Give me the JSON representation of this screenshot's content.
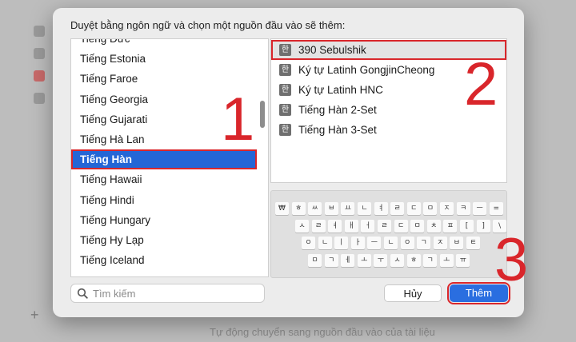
{
  "dialog": {
    "title": "Duyệt bằng ngôn ngữ và chọn một nguồn đầu vào sẽ thêm:"
  },
  "languages": [
    {
      "label": "Tiếng Đức",
      "selected": false
    },
    {
      "label": "Tiếng Estonia",
      "selected": false
    },
    {
      "label": "Tiếng Faroe",
      "selected": false
    },
    {
      "label": "Tiếng Georgia",
      "selected": false
    },
    {
      "label": "Tiếng Gujarati",
      "selected": false
    },
    {
      "label": "Tiếng Hà Lan",
      "selected": false
    },
    {
      "label": "Tiếng Hàn",
      "selected": true
    },
    {
      "label": "Tiếng Hawaii",
      "selected": false
    },
    {
      "label": "Tiếng Hindi",
      "selected": false
    },
    {
      "label": "Tiếng Hungary",
      "selected": false
    },
    {
      "label": "Tiếng Hy Lạp",
      "selected": false
    },
    {
      "label": "Tiếng Iceland",
      "selected": false
    }
  ],
  "sources": [
    {
      "label": "390 Sebulshik",
      "icon": "한",
      "selected": true
    },
    {
      "label": "Ký tự Latinh GongjinCheong",
      "icon": "한",
      "selected": false
    },
    {
      "label": "Ký tự Latinh HNC",
      "icon": "한",
      "selected": false
    },
    {
      "label": "Tiếng Hàn 2-Set",
      "icon": "한",
      "selected": false
    },
    {
      "label": "Tiếng Hàn 3-Set",
      "icon": "한",
      "selected": false
    }
  ],
  "keyboard": {
    "rows": [
      [
        "₩",
        "ㅎ",
        "ㅆ",
        "ㅂ",
        "ㅛ",
        "ㄴ",
        "ㅕ",
        "ㄹ",
        "ㄷ",
        "ㅁ",
        "ㅈ",
        "ㅋ",
        "ㅡ",
        "="
      ],
      [
        "ㅅ",
        "ㄹ",
        "ㅕ",
        "ㅐ",
        "ㅓ",
        "ㄹ",
        "ㄷ",
        "ㅁ",
        "ㅊ",
        "ㅍ",
        "[",
        "]",
        "\\"
      ],
      [
        "ㅇ",
        "ㄴ",
        "ㅣ",
        "ㅏ",
        "ㅡ",
        "ㄴ",
        "ㅇ",
        "ㄱ",
        "ㅈ",
        "ㅂ",
        "ㅌ"
      ],
      [
        "ㅁ",
        "ㄱ",
        "ㅔ",
        "ㅗ",
        "ㅜ",
        "ㅅ",
        "ㅎ",
        "ㄱ",
        "ㅗ",
        "ㅠ"
      ]
    ]
  },
  "search": {
    "placeholder": "Tìm kiếm"
  },
  "buttons": {
    "cancel": "Hủy",
    "add": "Thêm"
  },
  "annotations": [
    "1",
    "2",
    "3"
  ],
  "background": {
    "hint": "Tự động chuyển sang nguồn đầu vào của tài liệu"
  },
  "colors": {
    "accent": "#2466d6",
    "highlight": "#d9262b"
  }
}
